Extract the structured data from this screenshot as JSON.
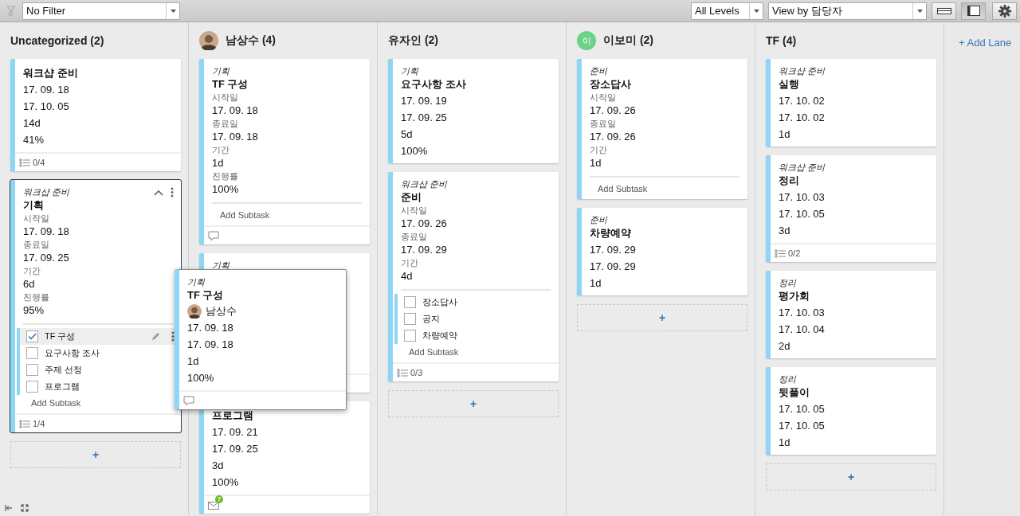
{
  "toolbar": {
    "filter_select": {
      "value": "No Filter"
    },
    "level_select": {
      "value": "All Levels"
    },
    "view_select": {
      "value": "View by 담당자"
    },
    "layout_toggles": [
      {
        "kind": "compact",
        "selected": false
      },
      {
        "kind": "panel",
        "selected": true
      }
    ]
  },
  "lanes": [
    {
      "name": "Uncategorized",
      "count": "(2)",
      "add_card": "+",
      "cards": [
        {
          "title": "워크샵 준비",
          "selected": false,
          "fields": [
            {
              "value": "17. 09. 18"
            },
            {
              "value": "17. 10. 05"
            },
            {
              "value": "14d"
            },
            {
              "value": "41%"
            }
          ],
          "footer": {
            "kind": "checklist",
            "text": "0/4"
          }
        },
        {
          "category": "워크샵 준비",
          "title": "기획",
          "selected": true,
          "fields": [
            {
              "label": "시작일",
              "value": "17. 09. 18"
            },
            {
              "label": "종료일",
              "value": "17. 09. 25"
            },
            {
              "label": "기간",
              "value": "6d"
            },
            {
              "label": "진행률",
              "value": "95%"
            }
          ],
          "subtasks": [
            {
              "label": "TF 구성",
              "checked": true,
              "selected": true
            },
            {
              "label": "요구사항 조사",
              "checked": false,
              "selected": false
            },
            {
              "label": "주제 선정",
              "checked": false,
              "selected": false
            },
            {
              "label": "프로그램",
              "checked": false,
              "selected": false
            }
          ],
          "add_subtask": "Add Subtask",
          "footer": {
            "kind": "checklist",
            "text": "1/4"
          }
        }
      ]
    },
    {
      "name": "남상수",
      "count": "(4)",
      "avatar": {
        "kind": "photo"
      },
      "cards": [
        {
          "category": "기획",
          "title": "TF 구성",
          "selected": false,
          "fields": [
            {
              "label": "시작일",
              "value": "17. 09. 18"
            },
            {
              "label": "종료일",
              "value": "17. 09. 18"
            },
            {
              "label": "기간",
              "value": "1d"
            },
            {
              "label": "진행률",
              "value": "100%"
            }
          ],
          "add_subtask": "Add Subtask",
          "footer": {
            "kind": "comment"
          }
        },
        {
          "category": "기획",
          "selected": false,
          "footer": {
            "kind": "blank"
          }
        },
        {
          "title": "프로그램",
          "selected": false,
          "fields": [
            {
              "value": "17. 09. 21"
            },
            {
              "value": "17. 09. 25"
            },
            {
              "value": "3d"
            },
            {
              "value": "100%"
            }
          ],
          "footer": {
            "kind": "mail",
            "badge": "?"
          }
        }
      ]
    },
    {
      "name": "유자인",
      "count": "(2)",
      "add_card": "+",
      "cards": [
        {
          "category": "기획",
          "title": "요구사항 조사",
          "selected": false,
          "fields": [
            {
              "value": "17. 09. 19"
            },
            {
              "value": "17. 09. 25"
            },
            {
              "value": "5d"
            },
            {
              "value": "100%"
            }
          ]
        },
        {
          "category": "워크샵 준비",
          "title": "준비",
          "selected": false,
          "fields": [
            {
              "label": "시작일",
              "value": "17. 09. 26"
            },
            {
              "label": "종료일",
              "value": "17. 09. 29"
            },
            {
              "label": "기간",
              "value": "4d"
            }
          ],
          "subtasks": [
            {
              "label": "장소답사",
              "checked": false,
              "selected": false
            },
            {
              "label": "공지",
              "checked": false,
              "selected": false
            },
            {
              "label": "차량예약",
              "checked": false,
              "selected": false
            }
          ],
          "add_subtask": "Add Subtask",
          "footer": {
            "kind": "checklist",
            "text": "0/3"
          }
        }
      ]
    },
    {
      "name": "이보미",
      "count": "(2)",
      "avatar": {
        "kind": "initial",
        "text": "이"
      },
      "add_card": "+",
      "cards": [
        {
          "category": "준비",
          "title": "장소답사",
          "selected": false,
          "fields": [
            {
              "label": "시작일",
              "value": "17. 09. 26"
            },
            {
              "label": "종료일",
              "value": "17. 09. 26"
            },
            {
              "label": "기간",
              "value": "1d"
            }
          ],
          "add_subtask": "Add Subtask"
        },
        {
          "category": "준비",
          "title": "차량예약",
          "selected": false,
          "fields": [
            {
              "value": "17. 09. 29"
            },
            {
              "value": "17. 09. 29"
            },
            {
              "value": "1d"
            }
          ]
        }
      ]
    },
    {
      "name": "TF",
      "count": "(4)",
      "add_card": "+",
      "cards": [
        {
          "category": "워크샵 준비",
          "title": "실행",
          "selected": false,
          "fields": [
            {
              "value": "17. 10. 02"
            },
            {
              "value": "17. 10. 02"
            },
            {
              "value": "1d"
            }
          ]
        },
        {
          "category": "워크샵 준비",
          "title": "정리",
          "selected": false,
          "fields": [
            {
              "value": "17. 10. 03"
            },
            {
              "value": "17. 10. 05"
            },
            {
              "value": "3d"
            }
          ],
          "footer": {
            "kind": "checklist",
            "text": "0/2"
          }
        },
        {
          "category": "정리",
          "title": "평가회",
          "selected": false,
          "fields": [
            {
              "value": "17. 10. 03"
            },
            {
              "value": "17. 10. 04"
            },
            {
              "value": "2d"
            }
          ]
        },
        {
          "category": "정리",
          "title": "뒷풀이",
          "selected": false,
          "fields": [
            {
              "value": "17. 10. 05"
            },
            {
              "value": "17. 10. 05"
            },
            {
              "value": "1d"
            }
          ]
        }
      ]
    }
  ],
  "add_lane": "+ Add Lane",
  "popup": {
    "category": "기획",
    "title": "TF 구성",
    "assignee": "남상수",
    "fields": [
      "17. 09. 18",
      "17. 09. 18",
      "1d",
      "100%"
    ],
    "footer": {
      "kind": "comment"
    }
  }
}
